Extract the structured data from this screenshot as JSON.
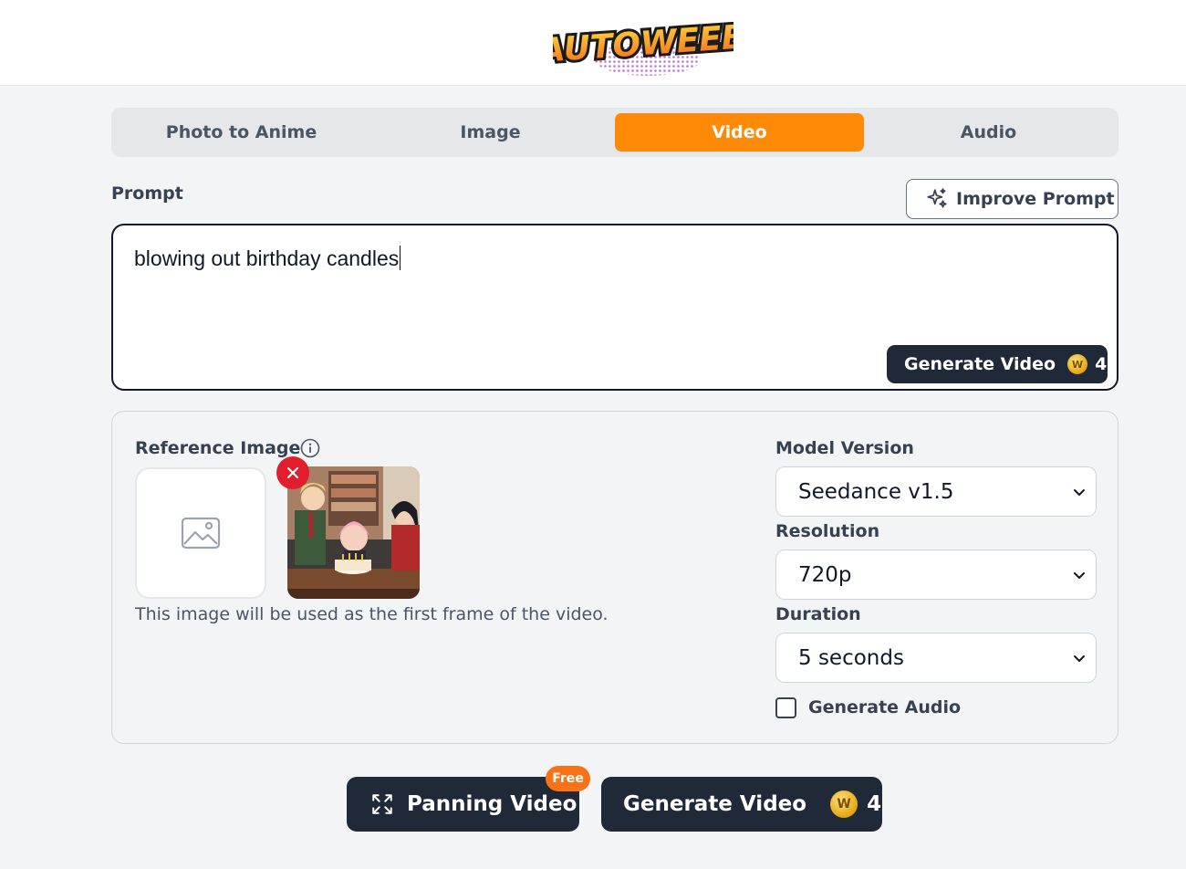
{
  "brand": {
    "logo_text": "AUTOWEEB"
  },
  "tabs": [
    {
      "label": "Photo to Anime",
      "active": false
    },
    {
      "label": "Image",
      "active": false
    },
    {
      "label": "Video",
      "active": true
    },
    {
      "label": "Audio",
      "active": false
    }
  ],
  "prompt": {
    "label": "Prompt",
    "improve_label": "Improve Prompt",
    "value": "blowing out birthday candles",
    "generate_label": "Generate Video",
    "cost": "4"
  },
  "reference": {
    "label": "Reference Image",
    "note": "This image will be used as the first frame of the video."
  },
  "settings": {
    "model_label": "Model Version",
    "model_value": "Seedance v1.5",
    "resolution_label": "Resolution",
    "resolution_value": "720p",
    "duration_label": "Duration",
    "duration_value": "5 seconds",
    "audio_label": "Generate Audio",
    "audio_checked": false
  },
  "actions": {
    "panning_label": "Panning Video",
    "free_badge": "Free",
    "generate_label": "Generate Video",
    "cost": "4"
  },
  "colors": {
    "accent": "#ff8a07",
    "dark_button": "#1f2937",
    "remove": "#e11d2e",
    "badge": "#f97316"
  }
}
